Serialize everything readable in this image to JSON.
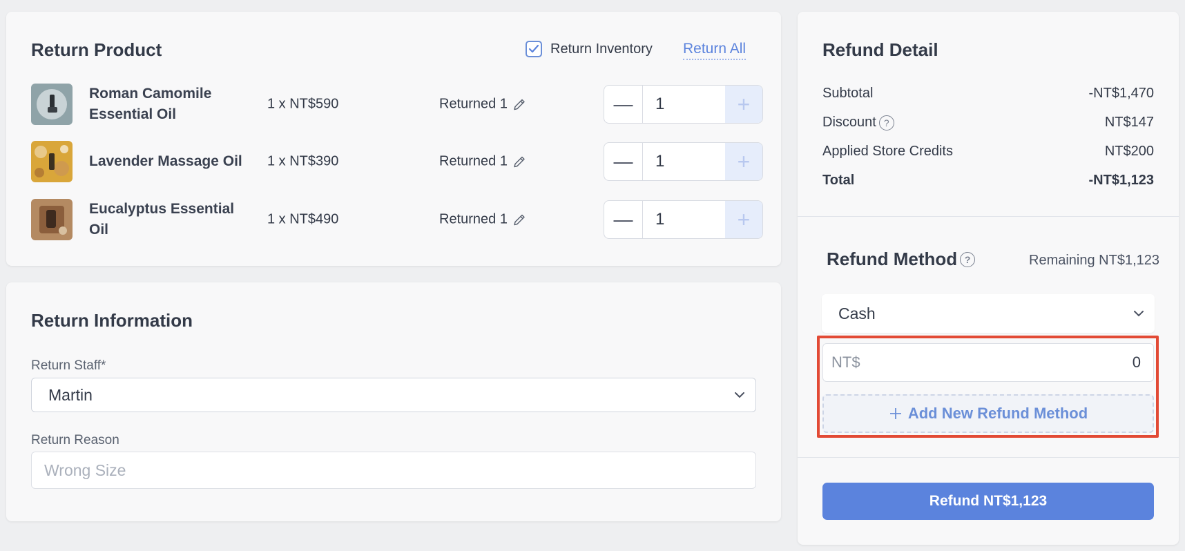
{
  "return_product": {
    "title": "Return Product",
    "return_inventory_label": "Return Inventory",
    "return_inventory_checked": true,
    "return_all_label": "Return All",
    "items": [
      {
        "name": "Roman Camomile Essential Oil",
        "price": "1 x NT$590",
        "returned": "Returned 1",
        "qty": "1"
      },
      {
        "name": "Lavender Massage Oil",
        "price": "1 x NT$390",
        "returned": "Returned 1",
        "qty": "1"
      },
      {
        "name": "Eucalyptus Essential Oil",
        "price": "1 x NT$490",
        "returned": "Returned 1",
        "qty": "1"
      }
    ]
  },
  "return_information": {
    "title": "Return Information",
    "staff_label": "Return Staff*",
    "staff_value": "Martin",
    "reason_label": "Return Reason",
    "reason_placeholder": "Wrong Size"
  },
  "refund_detail": {
    "title": "Refund Detail",
    "rows": [
      {
        "label": "Subtotal",
        "value": "-NT$1,470"
      },
      {
        "label": "Discount",
        "value": "NT$147"
      },
      {
        "label": "Applied Store Credits",
        "value": "NT$200"
      },
      {
        "label": "Total",
        "value": "-NT$1,123"
      }
    ]
  },
  "refund_method": {
    "title": "Refund Method",
    "remaining": "Remaining NT$1,123",
    "selected_method": "Cash",
    "amount_prefix": "NT$",
    "amount_value": "0",
    "add_method_label": "Add New Refund Method"
  },
  "refund_button_label": "Refund NT$1,123",
  "colors": {
    "accent": "#5b83dd",
    "highlight": "#e24a35",
    "background": "#eeeff1"
  }
}
